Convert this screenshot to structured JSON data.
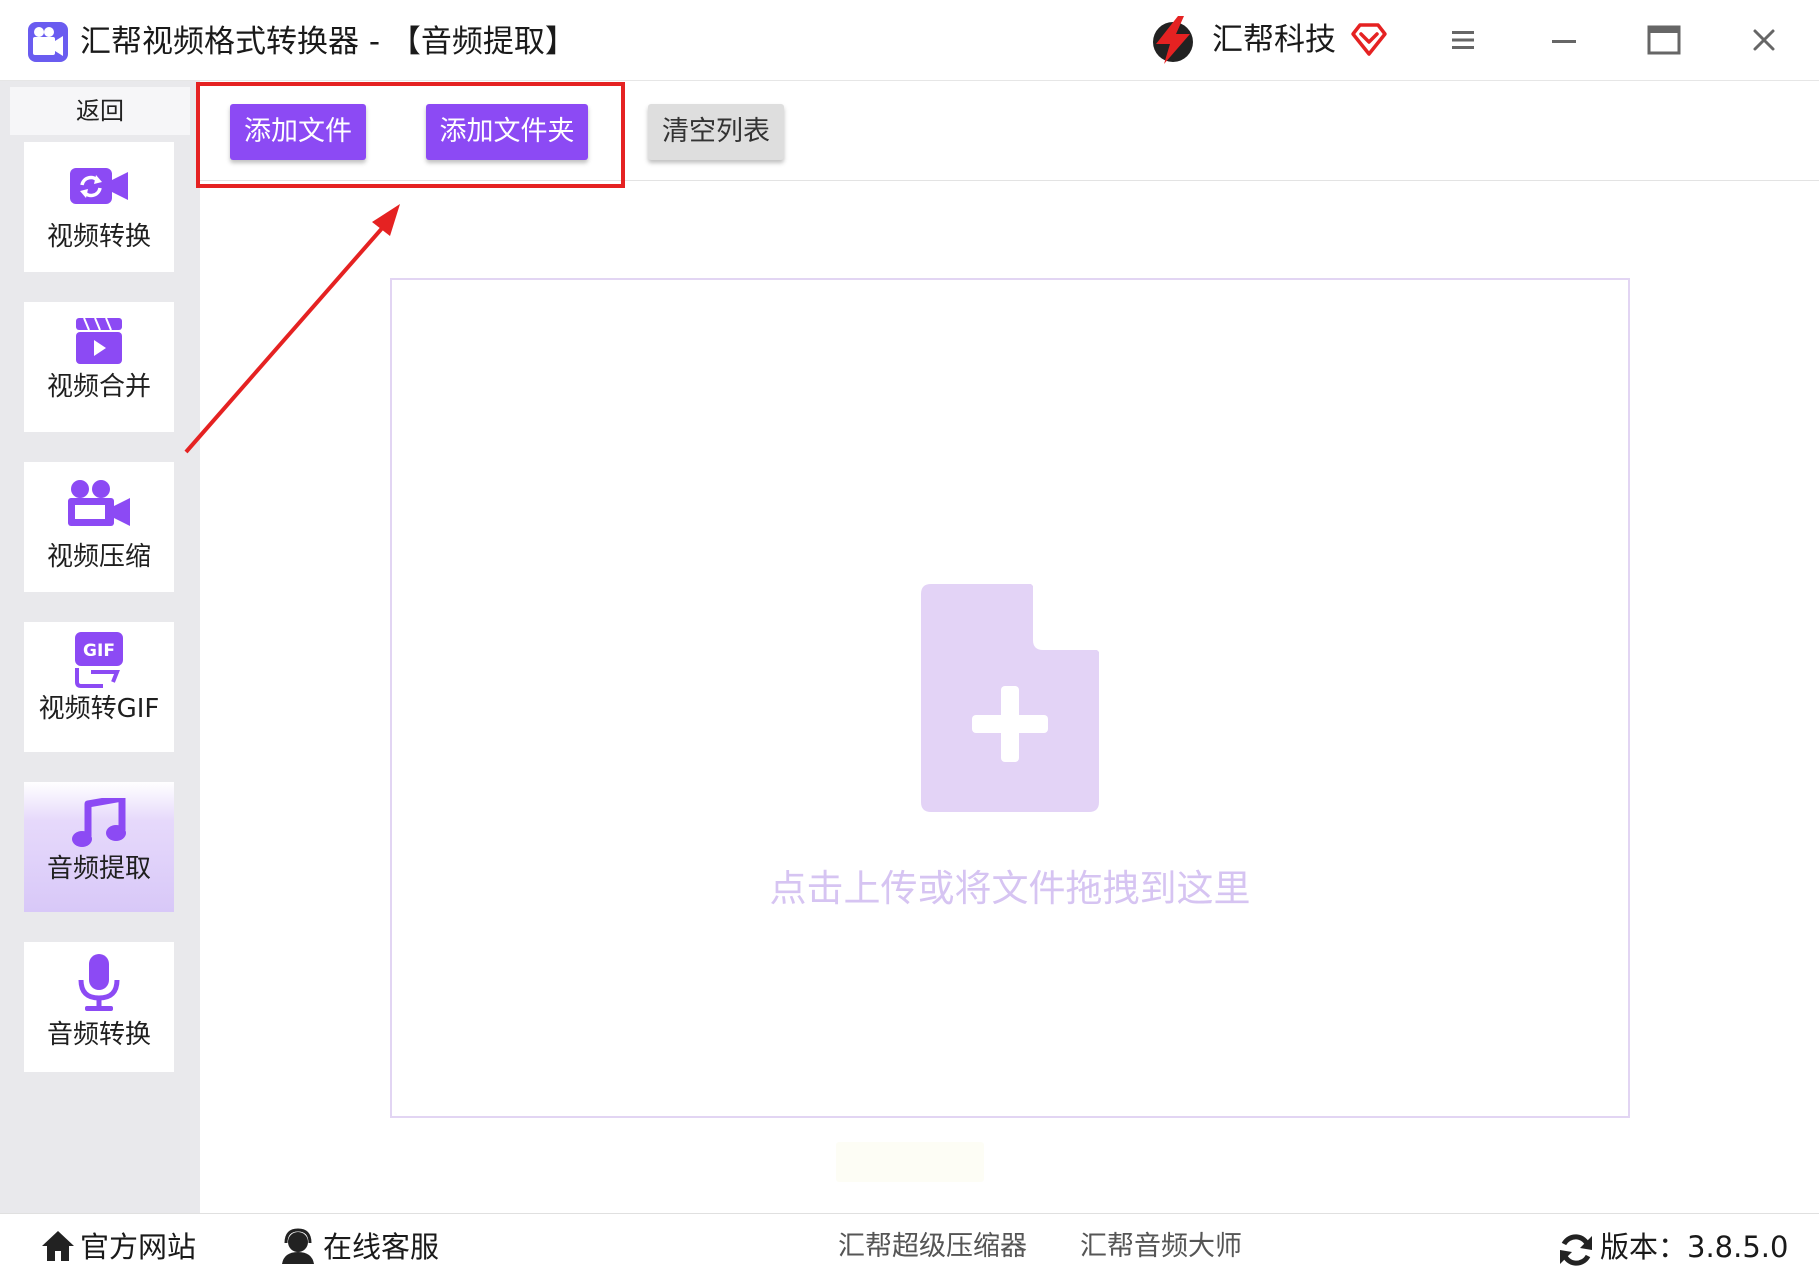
{
  "window": {
    "title": "汇帮视频格式转换器  - 【音频提取】",
    "brand": "汇帮科技"
  },
  "colors": {
    "accent": "#8c4af4",
    "highlight_frame": "#e52222",
    "dropzone_icon": "#e3d3f6",
    "hint_text": "#d6c4f2"
  },
  "sidebar": {
    "back_label": "返回",
    "items": [
      {
        "label": "视频转换",
        "icon": "video-convert-icon",
        "active": false
      },
      {
        "label": "视频合并",
        "icon": "video-merge-icon",
        "active": false
      },
      {
        "label": "视频压缩",
        "icon": "video-compress-icon",
        "active": false
      },
      {
        "label": "视频转GIF",
        "icon": "gif-icon",
        "active": false
      },
      {
        "label": "音频提取",
        "icon": "music-note-icon",
        "active": true
      },
      {
        "label": "音频转换",
        "icon": "microphone-icon",
        "active": false
      }
    ]
  },
  "toolbar": {
    "add_file": "添加文件",
    "add_folder": "添加文件夹",
    "clear_list": "清空列表"
  },
  "dropzone": {
    "hint": "点击上传或将文件拖拽到这里"
  },
  "footer": {
    "website": "官方网站",
    "support": "在线客服",
    "link_compressor": "汇帮超级压缩器",
    "link_audio": "汇帮音频大师",
    "version": "版本：3.8.5.0"
  }
}
